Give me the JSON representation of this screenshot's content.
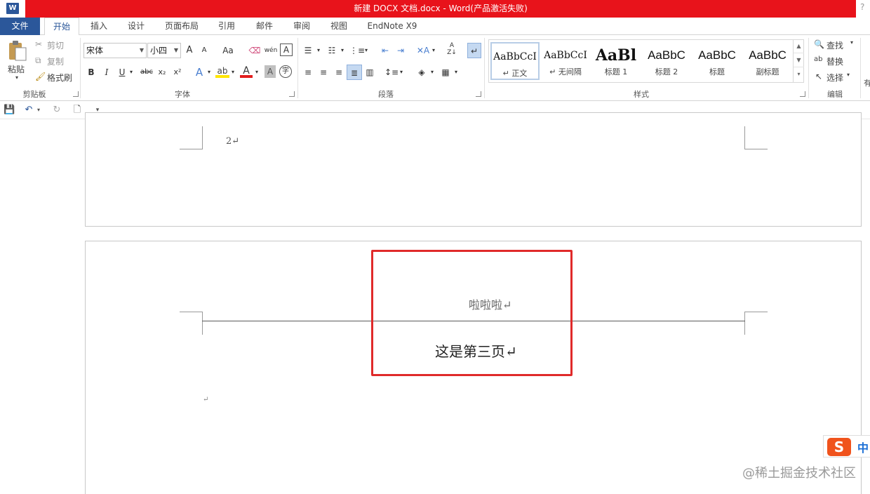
{
  "titlebar": {
    "app_icon": "W",
    "title": "新建 DOCX 文档.docx -  Word(产品激活失败)",
    "help": "?"
  },
  "tabs": [
    {
      "label": "文件"
    },
    {
      "label": "开始"
    },
    {
      "label": "插入"
    },
    {
      "label": "设计"
    },
    {
      "label": "页面布局"
    },
    {
      "label": "引用"
    },
    {
      "label": "邮件"
    },
    {
      "label": "审阅"
    },
    {
      "label": "视图"
    },
    {
      "label": "EndNote X9"
    }
  ],
  "clipboard": {
    "paste": "粘贴",
    "cut": "剪切",
    "copy": "复制",
    "format_painter": "格式刷",
    "label": "剪贴板"
  },
  "font": {
    "name": "宋体",
    "size": "小四",
    "grow": "A",
    "shrink": "A",
    "case": "Aa",
    "label": "字体",
    "bold": "B",
    "italic": "I",
    "underline": "U",
    "strike": "abc",
    "sub": "x₂",
    "sup": "x²",
    "effects": "A",
    "font_color": "A",
    "shading": "A",
    "phonetic": "wén",
    "border": "A",
    "enclose": "字"
  },
  "paragraph": {
    "label": "段落",
    "sort": "A↓Z",
    "show_marks": "↵"
  },
  "styles": {
    "label": "样式",
    "items": [
      {
        "sample": "AaBbCcI",
        "name": "↵ 正文"
      },
      {
        "sample": "AaBbCcI",
        "name": "↵ 无间隔"
      },
      {
        "sample": "AaBl",
        "name": "标题 1"
      },
      {
        "sample": "AaBbC",
        "name": "标题 2"
      },
      {
        "sample": "AaBbC",
        "name": "标题"
      },
      {
        "sample": "AaBbC",
        "name": "副标题"
      }
    ]
  },
  "editing": {
    "find": "查找",
    "replace": "替换",
    "select": "选择",
    "label": "编辑",
    "extra": "有"
  },
  "document": {
    "page2_number": "2↵",
    "header_text": "啦啦啦↵",
    "body_text": "这是第三页↵",
    "empty_para": "↵"
  },
  "ime": {
    "lang": "中",
    "logo": "S"
  },
  "watermark": "@稀土掘金技术社区",
  "colors": {
    "title_red": "#e8131b",
    "file_blue": "#2b579a",
    "highlight_red": "#e02a2a"
  }
}
